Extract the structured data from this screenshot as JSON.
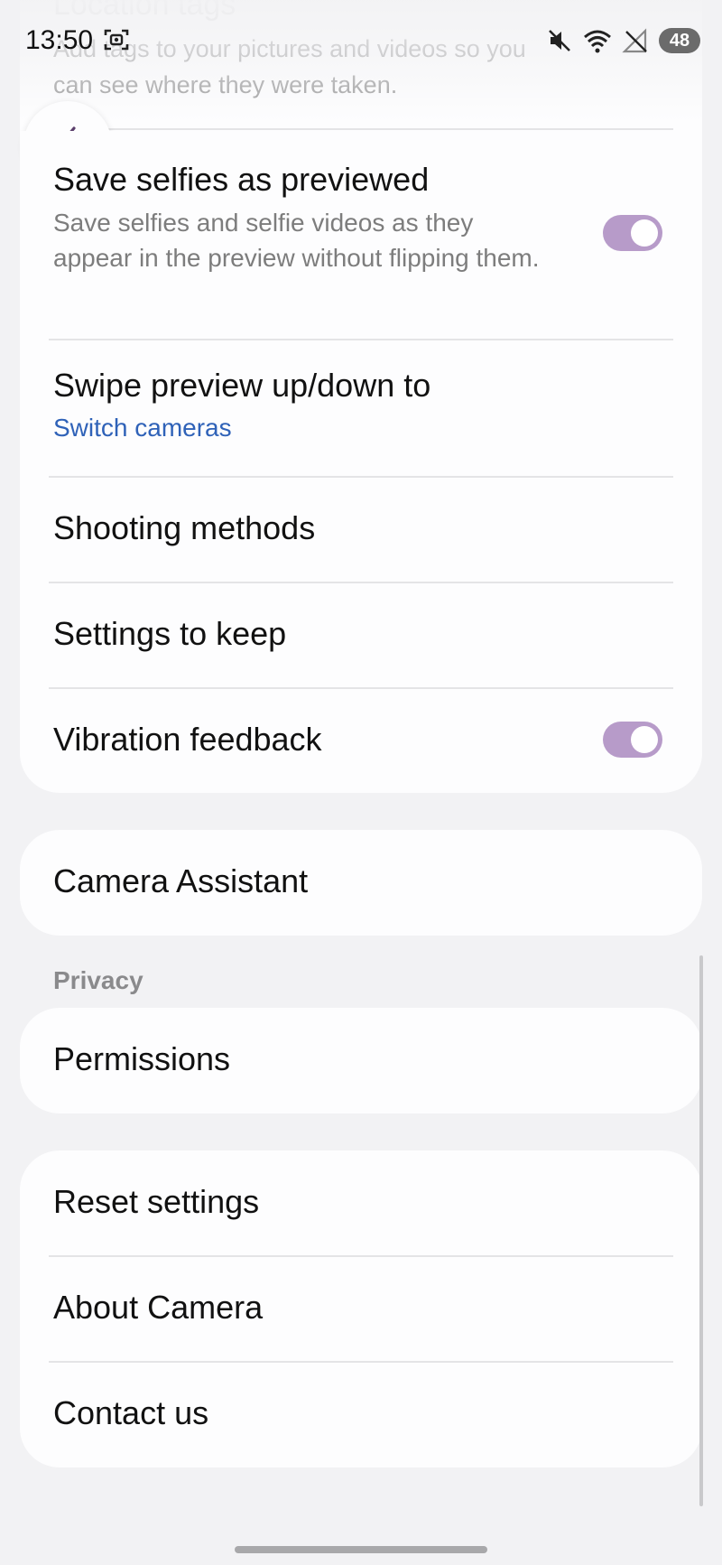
{
  "status_bar": {
    "time": "13:50",
    "battery": "48",
    "icons": [
      "screenshot-icon",
      "mute-icon",
      "wifi-icon",
      "no-signal-icon",
      "battery-icon"
    ]
  },
  "faded_header": {
    "title": "Location tags",
    "subtitle": "Add tags to your pictures and videos so you can see where they were taken."
  },
  "settings_card": {
    "items": [
      {
        "title": "Save selfies as previewed",
        "subtitle": "Save selfies and selfie videos as they appear in the preview without flipping them.",
        "toggle": "on"
      },
      {
        "title": "Swipe preview up/down to",
        "link": "Switch cameras"
      },
      {
        "title": "Shooting methods"
      },
      {
        "title": "Settings to keep"
      },
      {
        "title": "Vibration feedback",
        "toggle": "on"
      }
    ]
  },
  "assistant_card": {
    "title": "Camera Assistant"
  },
  "privacy": {
    "header": "Privacy",
    "items": [
      {
        "title": "Permissions"
      }
    ]
  },
  "info_card": {
    "items": [
      {
        "title": "Reset settings"
      },
      {
        "title": "About Camera"
      },
      {
        "title": "Contact us"
      }
    ]
  },
  "colors": {
    "background": "#f2f2f4",
    "card": "#fdfdfe",
    "toggle_on": "#b79bc9",
    "link": "#2f62b8",
    "secondary_text": "#7d7d7d"
  }
}
